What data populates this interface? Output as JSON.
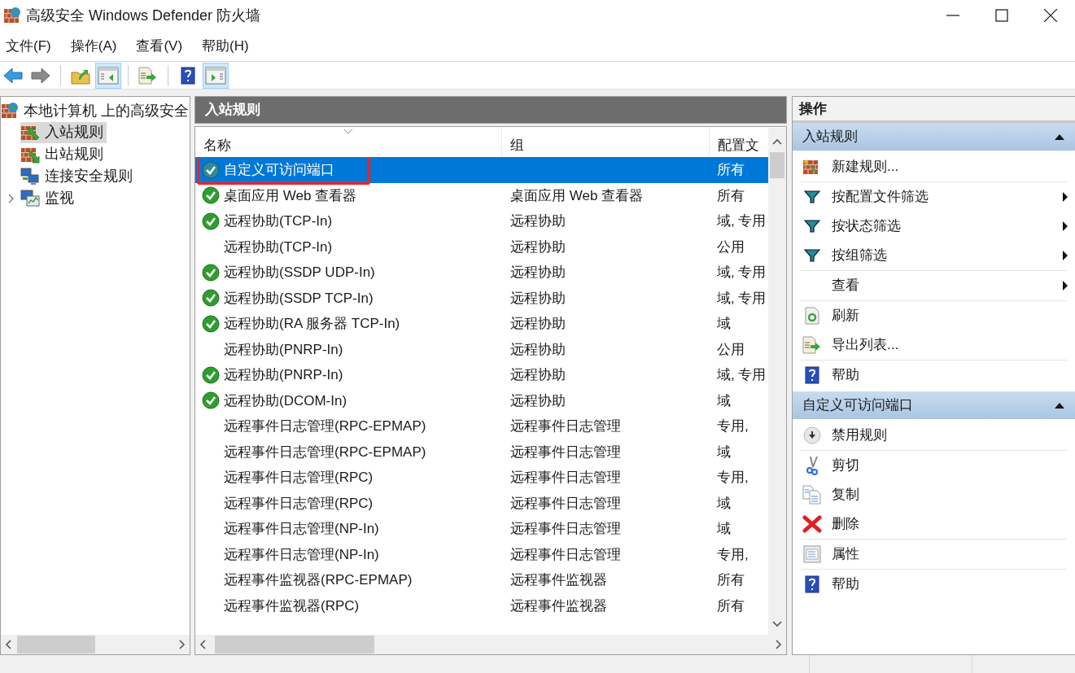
{
  "window": {
    "title": "高级安全 Windows Defender 防火墙"
  },
  "menu": [
    "文件(F)",
    "操作(A)",
    "查看(V)",
    "帮助(H)"
  ],
  "toolbar": [
    {
      "kind": "back",
      "pressed": false
    },
    {
      "kind": "forward",
      "pressed": false
    },
    {
      "kind": "separator"
    },
    {
      "kind": "up",
      "pressed": false
    },
    {
      "kind": "tree-pane",
      "pressed": true
    },
    {
      "kind": "separator"
    },
    {
      "kind": "export",
      "pressed": false
    },
    {
      "kind": "separator"
    },
    {
      "kind": "help",
      "pressed": false
    },
    {
      "kind": "action-pane",
      "pressed": true
    }
  ],
  "tree": {
    "label": "本地计算机 上的高级安全",
    "kind": "firewall",
    "children": [
      {
        "label": "入站规则",
        "kind": "inbound",
        "selected": true
      },
      {
        "label": "出站规则",
        "kind": "outbound",
        "selected": false
      },
      {
        "label": "连接安全规则",
        "kind": "connection",
        "selected": false
      },
      {
        "label": "监视",
        "kind": "monitor",
        "selected": false,
        "expanded": false
      }
    ]
  },
  "rules_panel": {
    "title": "入站规则",
    "columns": [
      "名称",
      "组",
      "配置文"
    ],
    "rows": [
      {
        "name": "自定义可访问端口",
        "profile": "所有",
        "enabled": true,
        "selected": true,
        "annotated": true
      },
      {
        "name": "桌面应用 Web 查看器",
        "group": "桌面应用 Web 查看器",
        "profile": "所有",
        "enabled": true,
        "selected": false,
        "annotated": false
      },
      {
        "name": "远程协助(TCP-In)",
        "group": "远程协助",
        "profile": "域, 专用",
        "enabled": true,
        "selected": false,
        "annotated": false
      },
      {
        "name": "远程协助(TCP-In)",
        "group": "远程协助",
        "profile": "公用",
        "enabled": false,
        "selected": false,
        "annotated": false
      },
      {
        "name": "远程协助(SSDP UDP-In)",
        "group": "远程协助",
        "profile": "域, 专用",
        "enabled": true,
        "selected": false,
        "annotated": false
      },
      {
        "name": "远程协助(SSDP TCP-In)",
        "group": "远程协助",
        "profile": "域, 专用",
        "enabled": true,
        "selected": false,
        "annotated": false
      },
      {
        "name": "远程协助(RA 服务器 TCP-In)",
        "group": "远程协助",
        "profile": "域",
        "enabled": true,
        "selected": false,
        "annotated": false
      },
      {
        "name": "远程协助(PNRP-In)",
        "group": "远程协助",
        "profile": "公用",
        "enabled": false,
        "selected": false,
        "annotated": false
      },
      {
        "name": "远程协助(PNRP-In)",
        "group": "远程协助",
        "profile": "域, 专用",
        "enabled": true,
        "selected": false,
        "annotated": false
      },
      {
        "name": "远程协助(DCOM-In)",
        "group": "远程协助",
        "profile": "域",
        "enabled": true,
        "selected": false,
        "annotated": false
      },
      {
        "name": "远程事件日志管理(RPC-EPMAP)",
        "group": "远程事件日志管理",
        "profile": "专用,",
        "enabled": false,
        "selected": false,
        "annotated": false
      },
      {
        "name": "远程事件日志管理(RPC-EPMAP)",
        "group": "远程事件日志管理",
        "profile": "域",
        "enabled": false,
        "selected": false,
        "annotated": false
      },
      {
        "name": "远程事件日志管理(RPC)",
        "group": "远程事件日志管理",
        "profile": "专用,",
        "enabled": false,
        "selected": false,
        "annotated": false
      },
      {
        "name": "远程事件日志管理(RPC)",
        "group": "远程事件日志管理",
        "profile": "域",
        "enabled": false,
        "selected": false,
        "annotated": false
      },
      {
        "name": "远程事件日志管理(NP-In)",
        "group": "远程事件日志管理",
        "profile": "域",
        "enabled": false,
        "selected": false,
        "annotated": false
      },
      {
        "name": "远程事件日志管理(NP-In)",
        "group": "远程事件日志管理",
        "profile": "专用,",
        "enabled": false,
        "selected": false,
        "annotated": false
      },
      {
        "name": "远程事件监视器(RPC-EPMAP)",
        "group": "远程事件监视器",
        "profile": "所有",
        "enabled": false,
        "selected": false,
        "annotated": false
      },
      {
        "name": "远程事件监视器(RPC)",
        "group": "远程事件监视器",
        "profile": "所有",
        "enabled": false,
        "selected": false,
        "annotated": false
      }
    ]
  },
  "actions_panel": {
    "title": "操作",
    "sections": [
      {
        "title": "入站规则",
        "expanded": true,
        "groups": [
          [
            {
              "label": "新建规则...",
              "kind": "new-rule",
              "submenu": false
            }
          ],
          [
            {
              "label": "按配置文件筛选",
              "kind": "filter",
              "submenu": true
            },
            {
              "label": "按状态筛选",
              "kind": "filter",
              "submenu": true
            },
            {
              "label": "按组筛选",
              "kind": "filter",
              "submenu": true
            }
          ],
          [
            {
              "label": "查看",
              "kind": "plain",
              "submenu": true
            }
          ],
          [
            {
              "label": "刷新",
              "kind": "refresh",
              "submenu": false
            },
            {
              "label": "导出列表...",
              "kind": "export",
              "submenu": false
            }
          ],
          [
            {
              "label": "帮助",
              "kind": "help",
              "submenu": false
            }
          ]
        ]
      },
      {
        "title": "自定义可访问端口",
        "expanded": true,
        "groups": [
          [
            {
              "label": "禁用规则",
              "kind": "disable",
              "submenu": false
            }
          ],
          [
            {
              "label": "剪切",
              "kind": "cut",
              "submenu": false
            },
            {
              "label": "复制",
              "kind": "copy",
              "submenu": false
            },
            {
              "label": "删除",
              "kind": "delete",
              "submenu": false
            }
          ],
          [
            {
              "label": "属性",
              "kind": "properties",
              "submenu": false
            }
          ],
          [
            {
              "label": "帮助",
              "kind": "help",
              "submenu": false
            }
          ]
        ]
      }
    ]
  }
}
